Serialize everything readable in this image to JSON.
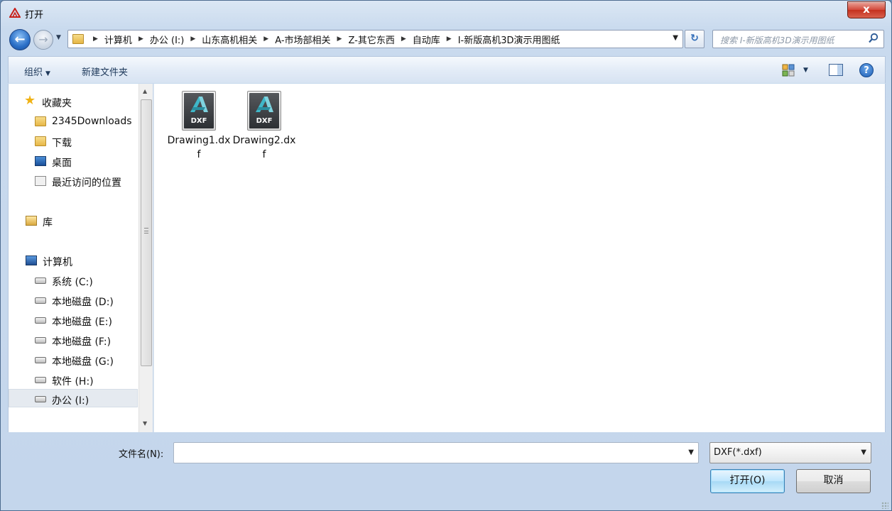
{
  "window": {
    "title": "打开",
    "close_label": "x"
  },
  "nav": {
    "back_glyph": "←",
    "forward_glyph": "→",
    "history_glyph": "▼",
    "breadcrumb": [
      "计算机",
      "办公 (I:)",
      "山东高机相关",
      "A-市场部相关",
      "Z-其它东西",
      "自动库",
      "I-新版高机3D演示用图纸"
    ],
    "refresh_glyph": "↻",
    "search_placeholder": "搜索 I-新版高机3D演示用图纸",
    "search_icon": "search-icon"
  },
  "toolbar": {
    "organize_label": "组织",
    "new_folder_label": "新建文件夹",
    "help_glyph": "?"
  },
  "sidebar": {
    "items": [
      {
        "label": "收藏夹",
        "icon": "star-icon",
        "kind": "group"
      },
      {
        "label": "2345Downloads",
        "icon": "folder-icon",
        "kind": "child"
      },
      {
        "label": "下载",
        "icon": "download-folder-icon",
        "kind": "child"
      },
      {
        "label": "桌面",
        "icon": "desktop-icon",
        "kind": "child"
      },
      {
        "label": "最近访问的位置",
        "icon": "recent-places-icon",
        "kind": "child"
      },
      {
        "label": "库",
        "icon": "library-icon",
        "kind": "group"
      },
      {
        "label": "计算机",
        "icon": "computer-icon",
        "kind": "group"
      },
      {
        "label": "系统 (C:)",
        "icon": "drive-icon",
        "kind": "child"
      },
      {
        "label": "本地磁盘 (D:)",
        "icon": "drive-icon",
        "kind": "child"
      },
      {
        "label": "本地磁盘 (E:)",
        "icon": "drive-icon",
        "kind": "child"
      },
      {
        "label": "本地磁盘 (F:)",
        "icon": "drive-icon",
        "kind": "child"
      },
      {
        "label": "本地磁盘 (G:)",
        "icon": "drive-icon",
        "kind": "child"
      },
      {
        "label": "软件 (H:)",
        "icon": "drive-icon",
        "kind": "child"
      },
      {
        "label": "办公 (I:)",
        "icon": "drive-icon",
        "kind": "child",
        "selected": true
      }
    ]
  },
  "files": [
    {
      "name": "Drawing1.dxf",
      "icon_badge": "DXF"
    },
    {
      "name": "Drawing2.dxf",
      "icon_badge": "DXF"
    }
  ],
  "footer": {
    "filename_label": "文件名(N):",
    "filename_value": "",
    "filetype_value": "DXF(*.dxf)",
    "dropdown_glyph": "▼",
    "open_label": "打开(O)",
    "cancel_label": "取消"
  },
  "colors": {
    "selection": "#e5eaf0",
    "accent": "#3c7fb1"
  }
}
